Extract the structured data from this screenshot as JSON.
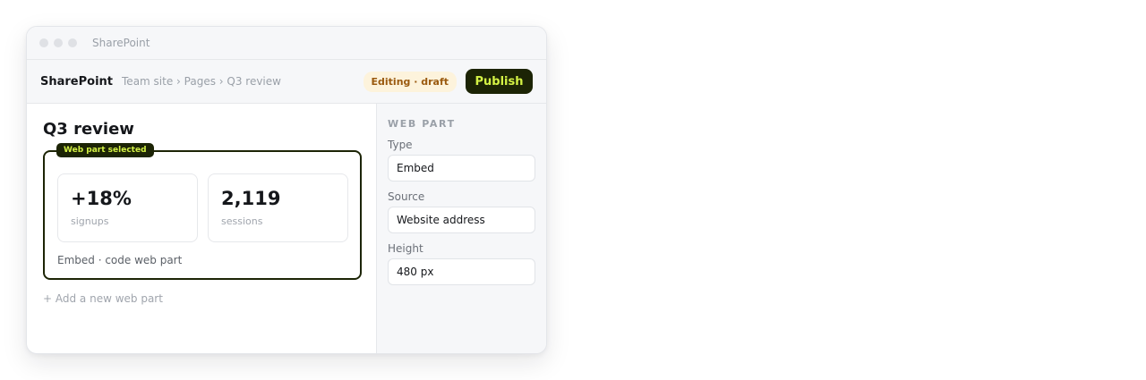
{
  "window": {
    "title": "SharePoint"
  },
  "appbar": {
    "brand": "SharePoint",
    "breadcrumb": "Team site › Pages › Q3 review",
    "status": "Editing · draft",
    "publish_label": "Publish"
  },
  "page": {
    "title": "Q3 review",
    "webpart": {
      "tag": "Web part selected",
      "stats": [
        {
          "value": "+18%",
          "label": "signups"
        },
        {
          "value": "2,119",
          "label": "sessions"
        }
      ],
      "caption": "Embed · code web part"
    },
    "add_webpart": "+ Add a new web part"
  },
  "panel": {
    "heading": "WEB PART",
    "fields": [
      {
        "label": "Type",
        "value": "Embed"
      },
      {
        "label": "Source",
        "value": "Website address"
      },
      {
        "label": "Height",
        "value": "480 px"
      }
    ]
  },
  "colors": {
    "accent_dark": "#1c2405",
    "accent_lime": "#d4f245",
    "badge_bg": "#fdf3dc",
    "badge_text": "#9a5a0f"
  }
}
